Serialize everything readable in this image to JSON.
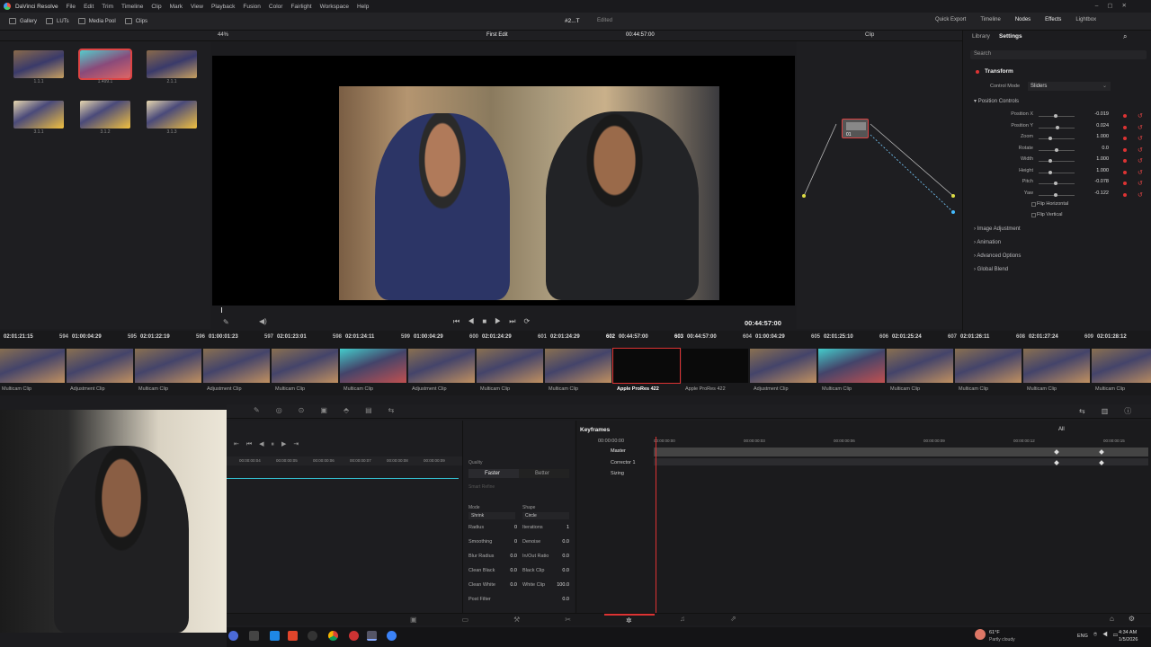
{
  "menubar": {
    "app": "DaVinci Resolve",
    "items": [
      "File",
      "Edit",
      "Trim",
      "Timeline",
      "Clip",
      "Mark",
      "View",
      "Playback",
      "Fusion",
      "Color",
      "Fairlight",
      "Workspace",
      "Help"
    ]
  },
  "topbar": {
    "left": [
      "Gallery",
      "LUTs",
      "Media Pool",
      "Clips"
    ],
    "center_title": "#2...T",
    "center_status": "Edited",
    "right": [
      "Quick Export",
      "Timeline",
      "Nodes",
      "Effects",
      "Lightbox"
    ]
  },
  "toolbar2": {
    "zoom": "44%",
    "timeline_name": "First Edit",
    "timecode": "00:44:57:00",
    "clip_mode": "Clip"
  },
  "mediapool": {
    "thumbs": [
      {
        "label": "1.1.1"
      },
      {
        "label": "1.499.1"
      },
      {
        "label": "2.1.1"
      },
      {
        "label": "3.1.1"
      },
      {
        "label": "3.1.2"
      },
      {
        "label": "3.1.3"
      }
    ]
  },
  "viewer": {
    "timecode": "00:44:57:00"
  },
  "node": {
    "label": "01"
  },
  "inspector": {
    "tabs": [
      "Library",
      "Settings"
    ],
    "search_placeholder": "Search",
    "section": "Transform",
    "control_mode_label": "Control Mode",
    "control_mode_value": "Sliders",
    "group": "Position Controls",
    "params": [
      {
        "name": "Position X",
        "value": "-0.019",
        "level": 0.48
      },
      {
        "name": "Position Y",
        "value": "0.024",
        "level": 0.52
      },
      {
        "name": "Zoom",
        "value": "1.000",
        "level": 0.33
      },
      {
        "name": "Rotate",
        "value": "0.0",
        "level": 0.5
      },
      {
        "name": "Width",
        "value": "1.000",
        "level": 0.33
      },
      {
        "name": "Height",
        "value": "1.000",
        "level": 0.33
      },
      {
        "name": "Pitch",
        "value": "-0.078",
        "level": 0.48
      },
      {
        "name": "Yaw",
        "value": "-0.122",
        "level": 0.47
      }
    ],
    "flip_h": "Flip Horizontal",
    "flip_v": "Flip Vertical",
    "collapsed": [
      "Image Adjustment",
      "Animation",
      "Advanced Options",
      "Global Blend"
    ]
  },
  "timeline": {
    "clips": [
      {
        "tc": "02:01:21:15",
        "num": "594",
        "name": "Multicam Clip"
      },
      {
        "tc": "01:00:04:29",
        "num": "595",
        "name": "Adjustment Clip"
      },
      {
        "tc": "02:01:22:19",
        "num": "596",
        "name": "Multicam Clip"
      },
      {
        "tc": "01:00:01:23",
        "num": "597",
        "name": "Adjustment Clip"
      },
      {
        "tc": "02:01:23:01",
        "num": "598",
        "name": "Multicam Clip"
      },
      {
        "tc": "02:01:24:11",
        "num": "599",
        "name": "Multicam Clip"
      },
      {
        "tc": "01:00:04:29",
        "num": "600",
        "name": "Adjustment Clip"
      },
      {
        "tc": "02:01:24:29",
        "num": "601",
        "name": "Multicam Clip"
      },
      {
        "tc": "02:01:24:29",
        "num": "602",
        "name": "Multicam Clip"
      },
      {
        "tc": "00:44:57:00",
        "num": "603",
        "name": "Apple ProRes 422"
      },
      {
        "tc": "00:44:57:00",
        "num": "604",
        "name": "Apple ProRes 422"
      },
      {
        "tc": "01:00:04:29",
        "num": "605",
        "name": "Adjustment Clip"
      },
      {
        "tc": "02:01:25:10",
        "num": "606",
        "name": "Multicam Clip"
      },
      {
        "tc": "02:01:25:24",
        "num": "607",
        "name": "Multicam Clip"
      },
      {
        "tc": "02:01:26:11",
        "num": "608",
        "name": "Multicam Clip"
      },
      {
        "tc": "02:01:27:24",
        "num": "609",
        "name": "Multicam Clip"
      },
      {
        "tc": "02:01:28:12",
        "num": "",
        "name": "Multicam Clip"
      }
    ]
  },
  "midpanel": {
    "ruler": [
      "00:00:00:04",
      "00:00:00:05",
      "00:00:00:06",
      "00:00:00:07",
      "00:00:00:08",
      "00:00:00:09"
    ]
  },
  "quality": {
    "title": "Quality",
    "faster": "Faster",
    "better": "Better",
    "smart_refine": "Smart Refine",
    "mode_label": "Mode",
    "mode_value": "Shrink",
    "shape_label": "Shape",
    "shape_value": "Circle",
    "params": [
      [
        "Radius",
        "0",
        "Iterations",
        "1"
      ],
      [
        "Smoothing",
        "0",
        "Denoise",
        "0.0"
      ],
      [
        "Blur Radius",
        "0.0",
        "In/Out Ratio",
        "0.0"
      ],
      [
        "Clean Black",
        "0.0",
        "Black Clip",
        "0.0"
      ],
      [
        "Clean White",
        "0.0",
        "White Clip",
        "100.0"
      ],
      [
        "Post Filter",
        "",
        "",
        "0.0"
      ]
    ]
  },
  "keyframes": {
    "title": "Keyframes",
    "filter": "All",
    "tc": "00:00:00:00",
    "ruler": [
      "00:00:00:00",
      "00:00:00:03",
      "00:00:00:06",
      "00:00:00:09",
      "00:00:00:12",
      "00:00:00:15"
    ],
    "tracks": [
      "Master",
      "Corrector 1",
      "Sizing"
    ]
  },
  "taskbar": {
    "weather": "61°F",
    "weather_desc": "Partly cloudy",
    "lang": "ENG",
    "time": "4:34 AM",
    "date": "1/5/2026"
  },
  "colors": {
    "accent": "#d43a3a",
    "bg": "#1c1c1f"
  }
}
